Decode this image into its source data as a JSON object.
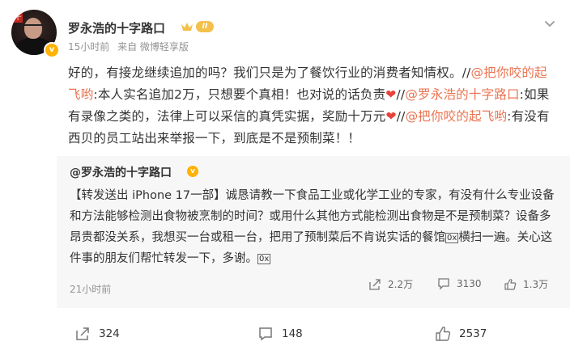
{
  "post": {
    "author": "罗永浩的十字路口",
    "level_badge": "II",
    "time": "15小时前",
    "source": "来自 微博轻享版",
    "segments": [
      {
        "t": "好的，有接龙继续追加的吗？我们只是为了餐饮行业的消费者知情权。//",
        "link": false
      },
      {
        "t": "@把你咬的起飞哟",
        "link": true
      },
      {
        "t": ":本人实名追加2万，只想要个真相！也对说的话负责",
        "link": false
      },
      {
        "t": "❤",
        "heart": true
      },
      {
        "t": "//",
        "link": false
      },
      {
        "t": "@罗永浩的十字路口",
        "link": true
      },
      {
        "t": ":如果有录像之类的，法律上可以采信的真凭实据，奖励十万元",
        "link": false
      },
      {
        "t": "❤",
        "heart": true
      },
      {
        "t": "//",
        "link": false
      },
      {
        "t": "@把你咬的起飞哟",
        "link": true
      },
      {
        "t": ":有没有西贝的员工站出来举报一下，到底是不是预制菜！！",
        "link": false
      }
    ]
  },
  "original": {
    "author": "@罗永浩的十字路口",
    "text_a": "【转发送出 iPhone 17一部】诚恳请教一下食品工业或化学工业的专家，有没有什么专业设备和方法能够检测出食物被烹制的时间？或用什么其他方式能检测出食物是不是预制菜？设备多昂贵都没关系，我想买一台或租一台，把用了预制菜后不肯说实话的餐馆",
    "glyph_a": "0x",
    "text_b": "横扫一遍。关心这件事的朋友们帮忙转发一下，多谢。",
    "glyph_b": "0x",
    "time": "21小时前",
    "reposts": "2.2万",
    "comments": "3130",
    "likes": "1.3万"
  },
  "actions": {
    "repost": "324",
    "comment": "148",
    "like": "2537"
  },
  "colors": {
    "link": "#eb7350",
    "heart": "#e8423a",
    "gold_badge": "#ffb200",
    "repost_bg": "#f7f7f7"
  }
}
